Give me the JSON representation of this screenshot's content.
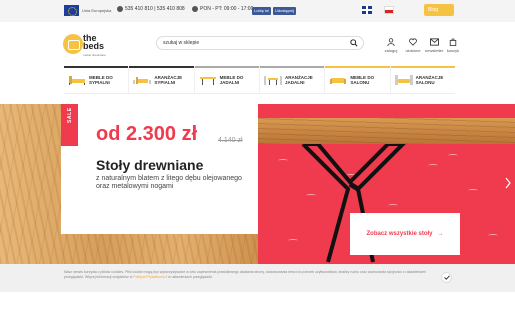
{
  "topbar": {
    "eu_label": "Unia Europejska",
    "phones": "535 410 810  |  535 410 808",
    "hours": "PON - PT: 09:00 - 17:00",
    "fb_like": "Lubię to!",
    "fb_share": "Udostępnij",
    "blog_label": "Blog"
  },
  "logo": {
    "line1": "the",
    "line2": "beds",
    "tagline": "meble drewniane"
  },
  "search": {
    "placeholder": "szukaj w sklepie"
  },
  "header_icons": {
    "login": "zaloguj",
    "favorites": "ulubione",
    "newsletter": "newsletter",
    "cart": "koszyk"
  },
  "categories": [
    {
      "label": "MEBLE DO SYPIALNI",
      "icon": "bed-icon",
      "accent": "#333333"
    },
    {
      "label": "ARANŻACJE SYPIALNI",
      "icon": "bed-arrangement-icon",
      "accent": "#333333"
    },
    {
      "label": "MEBLE DO JADALNI",
      "icon": "dining-table-icon",
      "accent": "#a9a9a9"
    },
    {
      "label": "ARANŻACJE JADALNI",
      "icon": "dining-arrangement-icon",
      "accent": "#a9a9a9"
    },
    {
      "label": "MEBLE DO SALONU",
      "icon": "sofa-icon",
      "accent": "#f6c244"
    },
    {
      "label": "ARANŻACJE SALONU",
      "icon": "living-arrangement-icon",
      "accent": "#f6c244"
    }
  ],
  "hero": {
    "sale_tag": "SALE",
    "price_new": "od 2.300 zł",
    "price_old": "4.140 zł",
    "title": "Stoły drewniane",
    "subtitle": "z naturalnym blatem z litego dębu olejowanego oraz metalowymi nogami",
    "cta_label": "Zobacz wszystkie stoły",
    "cta_arrow": "→"
  },
  "cookie": {
    "text": "Nasz serwis korzysta z plików cookies. Pliki cookie mogą być wykorzystywane w celu zapewnienia prawidłowego działania strony, dostosowania treści do potrzeb użytkowników, analizy ruchu oraz zachowania spójności z ustawieniami przeglądarki. Więcej informacji znajdziesz w",
    "link": "Polityce Prywatności",
    "text_end": "i w ustawieniach przeglądarki."
  },
  "colors": {
    "accent_red": "#f03b4e",
    "accent_yellow": "#f6c244"
  }
}
